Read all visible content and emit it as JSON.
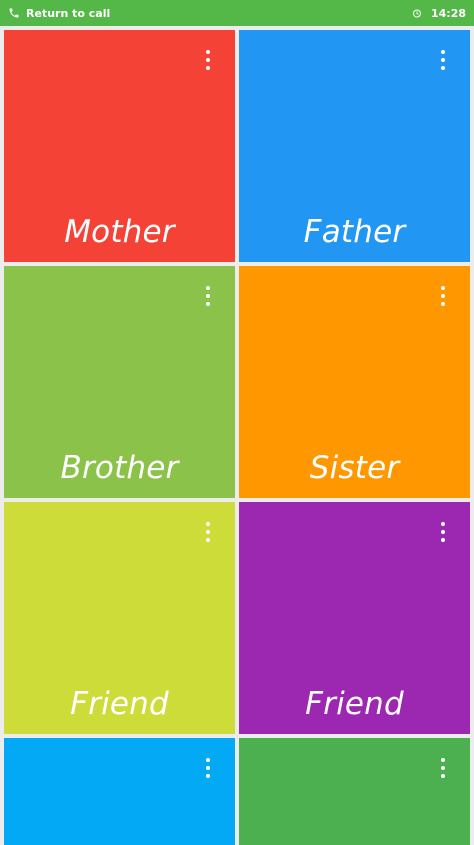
{
  "status_bar": {
    "return_text": "Return to call",
    "time": "14:28",
    "color": "#54b848"
  },
  "tiles": [
    {
      "label": "Mother",
      "color": "#f44336"
    },
    {
      "label": "Father",
      "color": "#2196f3"
    },
    {
      "label": "Brother",
      "color": "#8bc34a"
    },
    {
      "label": "Sister",
      "color": "#ff9800"
    },
    {
      "label": "Friend",
      "color": "#cddc39"
    },
    {
      "label": "Friend",
      "color": "#9c27b0"
    },
    {
      "label": "",
      "color": "#03a9f4"
    },
    {
      "label": "",
      "color": "#4caf50"
    }
  ],
  "icons": {
    "status_left": "phone-icon",
    "status_right": "alarm-icon",
    "tile_menu": "more-vert-icon"
  }
}
